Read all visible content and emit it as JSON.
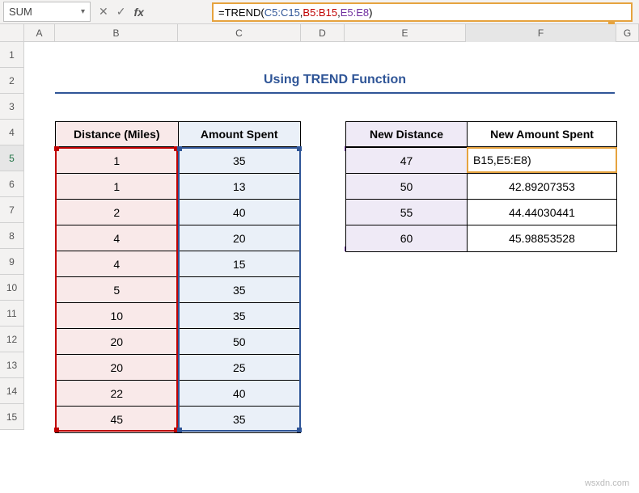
{
  "namebox": {
    "value": "SUM"
  },
  "formula": {
    "eq": "=",
    "fn": "TREND",
    "open": "(",
    "ref1": "C5:C15",
    "c1": ",",
    "ref2": "B5:B15",
    "c2": ",",
    "ref3": "E5:E8",
    "close": ")"
  },
  "columns": [
    "",
    "A",
    "B",
    "C",
    "D",
    "E",
    "F",
    "G"
  ],
  "rows": [
    "1",
    "2",
    "3",
    "4",
    "5",
    "6",
    "7",
    "8",
    "9",
    "10",
    "11",
    "12",
    "13",
    "14",
    "15"
  ],
  "title": "Using TREND Function",
  "table1": {
    "headers": [
      "Distance (Miles)",
      "Amount Spent"
    ],
    "data": [
      [
        "1",
        "35"
      ],
      [
        "1",
        "13"
      ],
      [
        "2",
        "40"
      ],
      [
        "4",
        "20"
      ],
      [
        "4",
        "15"
      ],
      [
        "5",
        "35"
      ],
      [
        "10",
        "35"
      ],
      [
        "20",
        "50"
      ],
      [
        "20",
        "25"
      ],
      [
        "22",
        "40"
      ],
      [
        "45",
        "35"
      ]
    ]
  },
  "table2": {
    "headers": [
      "New Distance",
      "New Amount Spent"
    ],
    "data": [
      [
        "47",
        ""
      ],
      [
        "50",
        "42.89207353"
      ],
      [
        "55",
        "44.44030441"
      ],
      [
        "60",
        "45.98853528"
      ]
    ]
  },
  "editing_cell_text": "B15,E5:E8)",
  "watermark": "wsxdn.com",
  "icons": {
    "dropdown": "▾",
    "cancel": "✕",
    "enter": "✓",
    "fx": "fx"
  }
}
